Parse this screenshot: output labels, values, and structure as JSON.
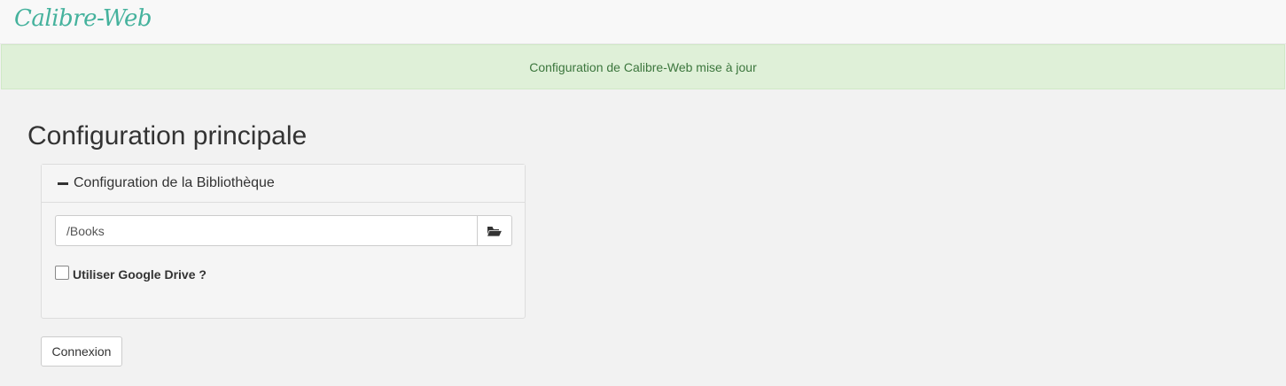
{
  "navbar": {
    "brand": "Calibre-Web"
  },
  "alert": {
    "message": "Configuration de Calibre-Web mise à jour",
    "color": "#3c763d",
    "background": "#dff0d8"
  },
  "page": {
    "title": "Configuration principale"
  },
  "library_panel": {
    "heading": "Configuration de la Bibliothèque",
    "heading_icon": "minus-icon",
    "path_input": {
      "value": "/Books",
      "placeholder": ""
    },
    "browse_icon": "folder-open-icon",
    "google_drive_checkbox": {
      "label": "Utiliser Google Drive ?",
      "checked": false
    }
  },
  "actions": {
    "connect_label": "Connexion"
  },
  "colors": {
    "brand": "#45b29d",
    "page_background": "#f2f2f2"
  }
}
